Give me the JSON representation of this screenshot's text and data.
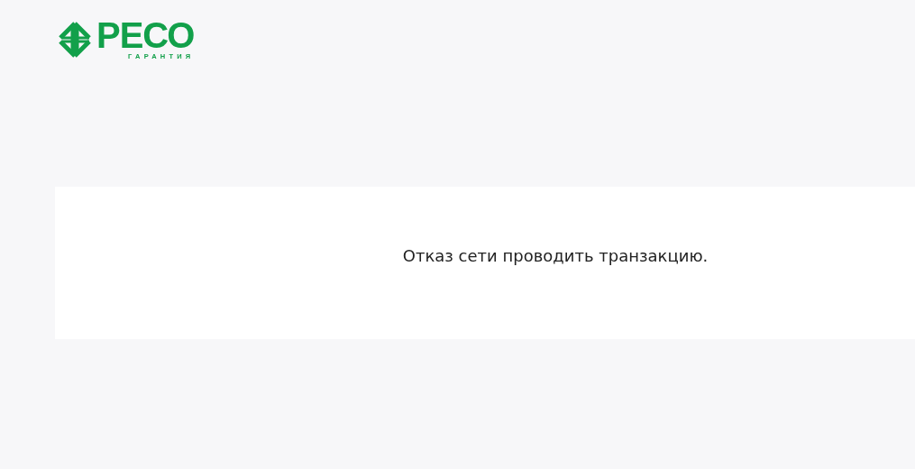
{
  "logo": {
    "name": "РЕСО",
    "tagline": "ГАРАНТИЯ"
  },
  "message": "Отказ сети проводить транзакцию."
}
